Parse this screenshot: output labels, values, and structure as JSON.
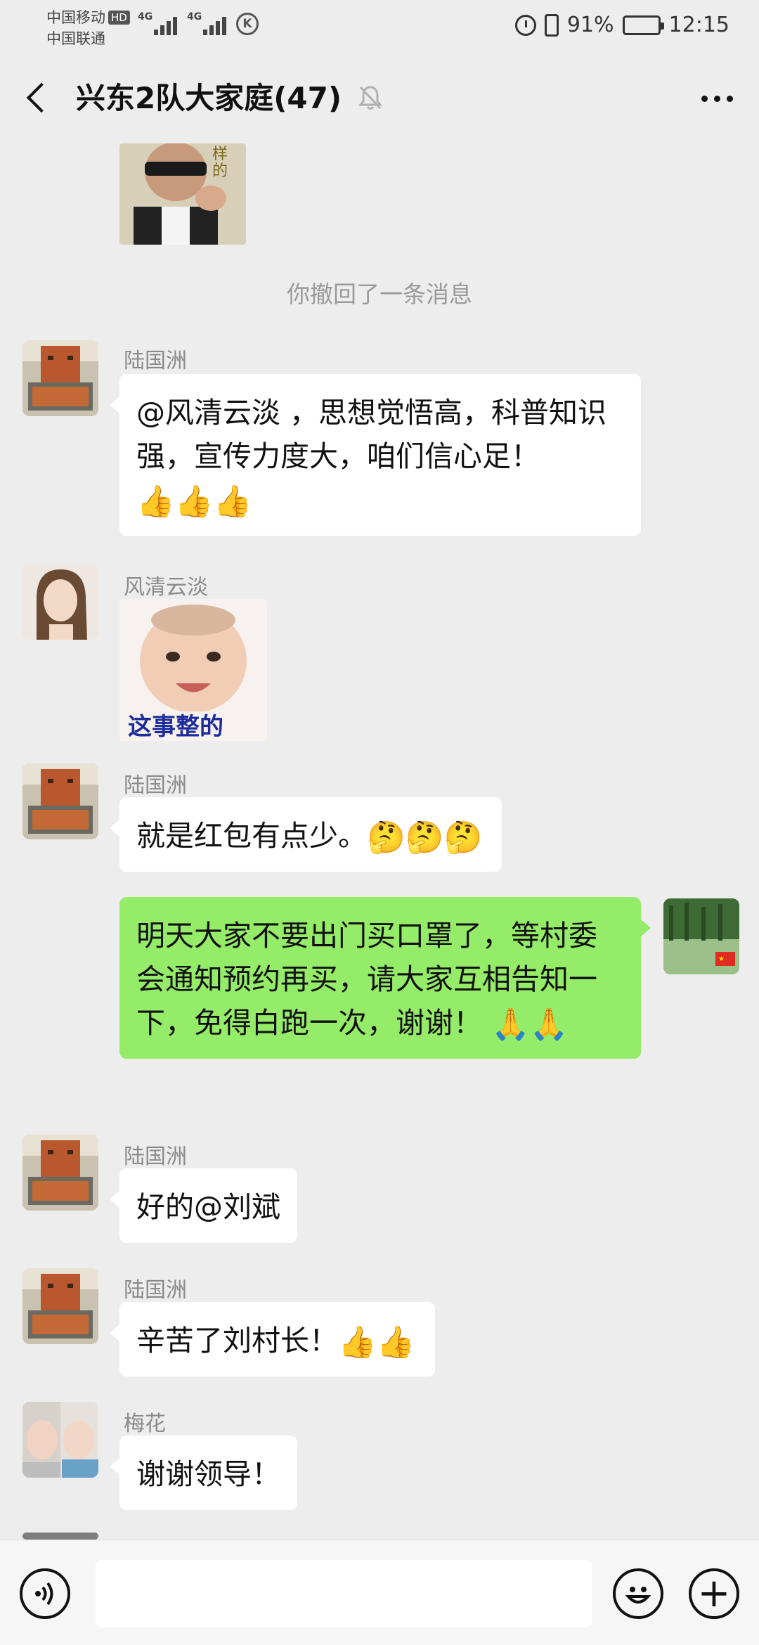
{
  "status_bar": {
    "carrier1": "中国移动",
    "hd_badge": "HD",
    "carrier2": "中国联通",
    "network1": "4G",
    "network2": "4G",
    "k_icon": "K",
    "battery_pct": "91%",
    "time": "12:15",
    "battery_level": 0.91
  },
  "header": {
    "title": "兴东2队大家庭(47)",
    "mute_icon": "bell-off-icon",
    "more_icon": "more-dots-icon"
  },
  "system_message": "你撤回了一条消息",
  "messages": [
    {
      "sender": "陆国洲",
      "text": "@风清云淡 ，思想觉悟高，科普知识强，宣传力度大，咱们信心足！",
      "emoji": "👍👍👍"
    },
    {
      "sender": "风清云淡",
      "sticker_caption": "这事整的"
    },
    {
      "sender": "陆国洲",
      "text": "就是红包有点少。",
      "emoji": "🤔🤔🤔"
    },
    {
      "sender": "me",
      "text": "明天大家不要出门买口罩了，等村委会通知预约再买，请大家互相告知一下，免得白跑一次，谢谢！",
      "emoji": "🙏🙏"
    },
    {
      "sender": "陆国洲",
      "text": "好的@刘斌"
    },
    {
      "sender": "陆国洲",
      "text": "辛苦了刘村长！",
      "emoji": "👍👍"
    },
    {
      "sender": "梅花",
      "text": "谢谢领导！"
    }
  ],
  "input_bar": {
    "voice_icon": "voice-icon",
    "emoji_icon": "emoji-icon",
    "plus_icon": "plus-icon",
    "plus_label": "+"
  }
}
